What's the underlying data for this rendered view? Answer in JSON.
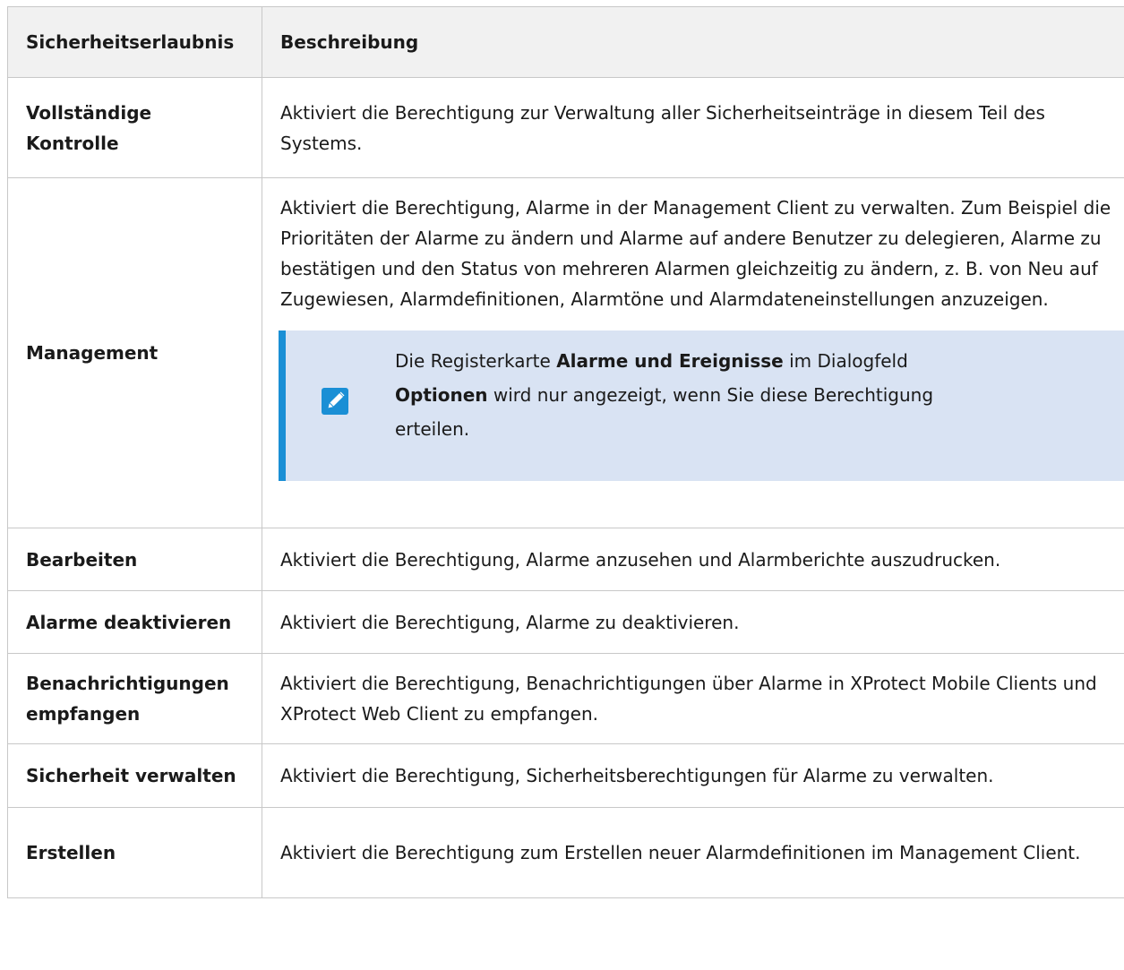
{
  "table": {
    "headers": [
      "Sicherheitserlaubnis",
      "Beschreibung"
    ],
    "rows": [
      {
        "name_line1": "Vollständige",
        "name_line2": "Kontrolle",
        "description": "Aktiviert die Berechtigung zur Verwaltung aller Sicherheitseinträge in diesem Teil des Systems."
      },
      {
        "name": "Management",
        "description": "Aktiviert die Berechtigung, Alarme in der Management Client zu verwalten. Zum Beispiel die Prioritäten der Alarme zu ändern und Alarme auf andere Benutzer zu delegieren, Alarme zu bestätigen und den Status von mehreren Alarmen gleichzeitig zu ändern, z. B. von Neu auf Zugewiesen, Alarmdefinitionen, Alarmtöne und Alarmdateneinstellungen anzuzeigen.",
        "note": {
          "icon": "pencil-note-icon",
          "text_1": "Die Registerkarte ",
          "bold_1": "Alarme und Ereignisse",
          "text_2": " im Dialogfeld ",
          "bold_2": "Optionen",
          "text_3": " wird nur angezeigt, wenn Sie diese Berechtigung erteilen."
        }
      },
      {
        "name": "Bearbeiten",
        "description": "Aktiviert die Berechtigung, Alarme anzusehen und Alarmberichte auszudrucken."
      },
      {
        "name": "Alarme deaktivieren",
        "description": "Aktiviert die Berechtigung, Alarme zu deaktivieren."
      },
      {
        "name_line1": "Benachrichtigungen",
        "name_line2": "empfangen",
        "description": "Aktiviert die Berechtigung, Benachrichtigungen über Alarme in XProtect Mobile Clients und XProtect Web Client zu empfangen."
      },
      {
        "name": "Sicherheit verwalten",
        "description": "Aktiviert die Berechtigung, Sicherheitsberechtigungen für Alarme zu verwalten."
      },
      {
        "name": "Erstellen",
        "description": "Aktiviert die Berechtigung zum Erstellen neuer Alarmdefinitionen im Management Client."
      }
    ]
  },
  "colors": {
    "header_bg": "#f1f1f1",
    "border": "#c8c8c8",
    "note_bg": "#d9e3f3",
    "note_accent": "#1a8fd5"
  }
}
